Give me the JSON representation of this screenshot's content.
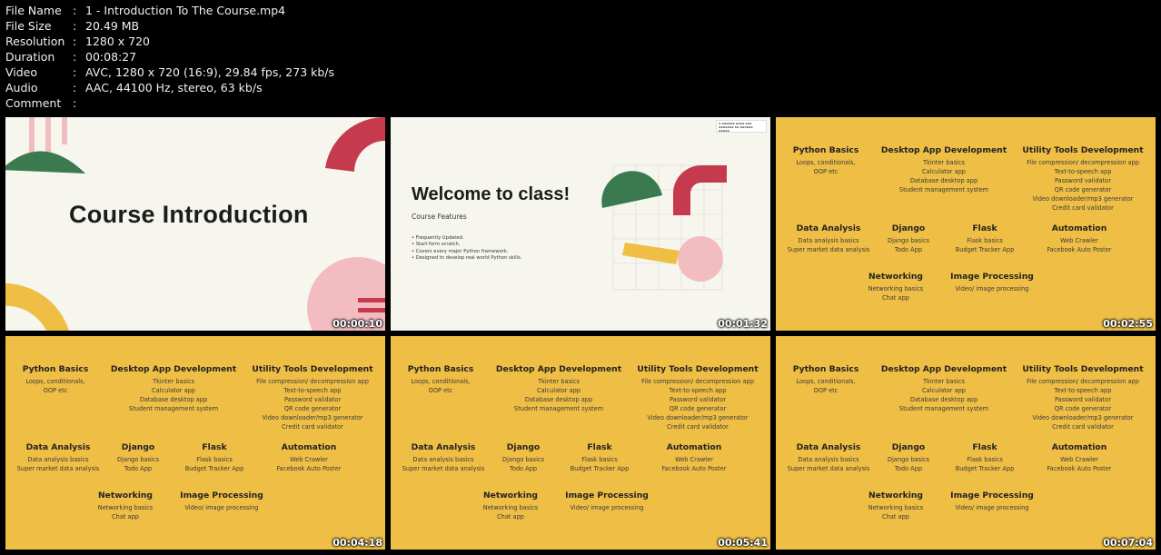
{
  "file_info": [
    {
      "key": "File Name",
      "value": "1 - Introduction To The Course.mp4"
    },
    {
      "key": "File Size",
      "value": "20.49 MB"
    },
    {
      "key": "Resolution",
      "value": "1280 x 720"
    },
    {
      "key": "Duration",
      "value": "00:08:27"
    },
    {
      "key": "Video",
      "value": "AVC, 1280 x 720 (16:9), 29.84 fps, 273 kb/s"
    },
    {
      "key": "Audio",
      "value": "AAC, 44100 Hz, stereo, 63 kb/s"
    },
    {
      "key": "Comment",
      "value": ""
    }
  ],
  "separator": ":",
  "thumbnails": {
    "t1": {
      "timestamp": "00:00:10",
      "title": "Course Introduction"
    },
    "t2": {
      "timestamp": "00:01:32",
      "title": "Welcome to class!",
      "subtitle": "Course Features",
      "bullets": [
        "Frequently Updated.",
        "Start form scratch.",
        "Covers every major Python framework.",
        "Designed to develop real world Python skills."
      ]
    },
    "t3": {
      "timestamp": "00:02:55"
    },
    "t4": {
      "timestamp": "00:04:18"
    },
    "t5": {
      "timestamp": "00:05:41"
    },
    "t6": {
      "timestamp": "00:07:04"
    }
  },
  "outline": {
    "python_basics": {
      "heading": "Python Basics",
      "items": [
        "Loops, conditionals,",
        "OOP etc"
      ]
    },
    "desktop_app": {
      "heading": "Desktop App Development",
      "items": [
        "Tkinter basics",
        "Calculator app",
        "Database desktop app",
        "Student management system"
      ]
    },
    "utility_tools": {
      "heading": "Utility Tools Development",
      "items": [
        "File compression/ decompression app",
        "Text-to-speech app",
        "Password validator",
        "QR code generator",
        "Video downloader/mp3 generator",
        "Credit card validator"
      ]
    },
    "data_analysis": {
      "heading": "Data Analysis",
      "items": [
        "Data analysis basics",
        "Super market data analysis"
      ]
    },
    "django": {
      "heading": "Django",
      "items": [
        "Django basics",
        "Todo App"
      ]
    },
    "flask": {
      "heading": "Flask",
      "items": [
        "Flask basics",
        "Budget Tracker App"
      ]
    },
    "automation": {
      "heading": "Automation",
      "items": [
        "Web Crawler",
        "Facebook Auto Poster"
      ]
    },
    "networking": {
      "heading": "Networking",
      "items": [
        "Networking basics",
        "Chat app"
      ]
    },
    "image_processing": {
      "heading": "Image Processing",
      "items": [
        "Video/  image processing"
      ]
    }
  },
  "colors": {
    "slide_yellow": "#efbe45",
    "slide_cream": "#f6f6ee",
    "accent_red": "#c63a4e",
    "accent_green": "#3a7a4e",
    "accent_pink": "#f2bcc0"
  }
}
